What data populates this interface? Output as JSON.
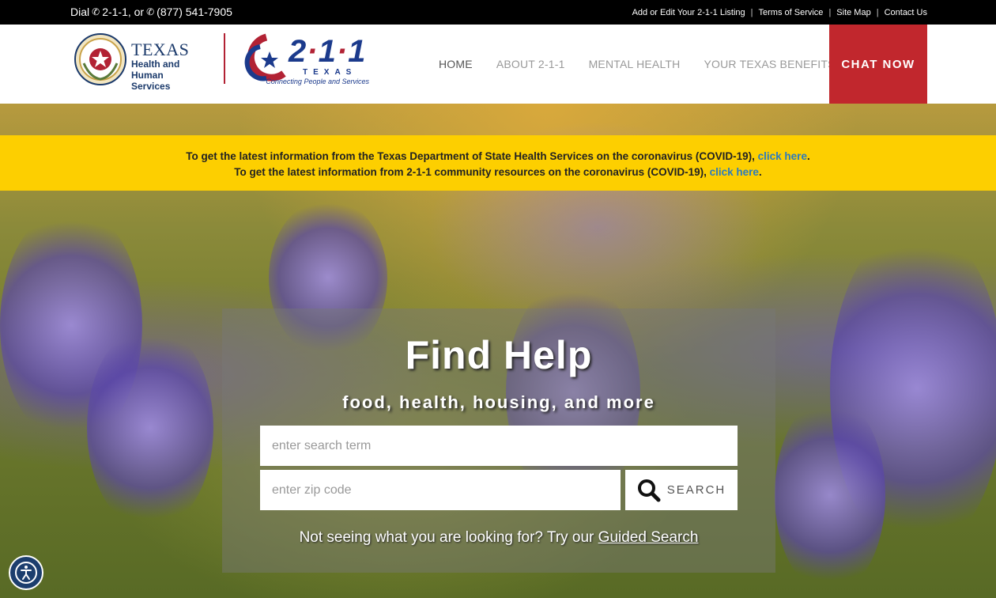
{
  "topbar": {
    "dial_prefix": "Dial",
    "dial_211": "2-1-1, or",
    "dial_number": "(877) 541-7905",
    "links": [
      "Add or Edit Your 2-1-1 Listing",
      "Terms of Service",
      "Site Map",
      "Contact Us"
    ],
    "separator": "|"
  },
  "header": {
    "hhs_logo": {
      "line1": "TEXAS",
      "line2": "Health and Human",
      "line3": "Services"
    },
    "logo_211": {
      "num_a": "2",
      "dot": "·",
      "num_b": "1",
      "num_c": "1",
      "texas": "TEXAS",
      "tagline": "Connecting People and Services"
    },
    "nav": [
      {
        "label": "HOME",
        "active": true
      },
      {
        "label": "ABOUT 2-1-1",
        "active": false
      },
      {
        "label": "MENTAL HEALTH",
        "active": false
      },
      {
        "label": "YOUR TEXAS BENEFITS",
        "active": false
      }
    ],
    "chat_label": "CHAT NOW"
  },
  "alert": {
    "line1_text": "To get the latest information from the Texas Department of State Health Services on the coronavirus (COVID-19), ",
    "line1_link": "click here",
    "line2_text": "To get the latest information from 2-1-1 community resources on the coronavirus (COVID-19), ",
    "line2_link": "click here",
    "period": "."
  },
  "find": {
    "title": "Find Help",
    "subtitle": "food, health, housing, and more",
    "search_placeholder": "enter search term",
    "zip_placeholder": "enter zip code",
    "search_label": "SEARCH",
    "guided_text": "Not seeing what you are looking for? Try our ",
    "guided_link": "Guided Search"
  },
  "colors": {
    "chat_bg": "#c1272d",
    "alert_bg": "#fdcf00",
    "link": "#2b7bbf",
    "brand_blue": "#1b3a8c"
  },
  "icons": {
    "phone": "phone-icon",
    "search": "search-icon",
    "accessibility": "accessibility-icon"
  }
}
